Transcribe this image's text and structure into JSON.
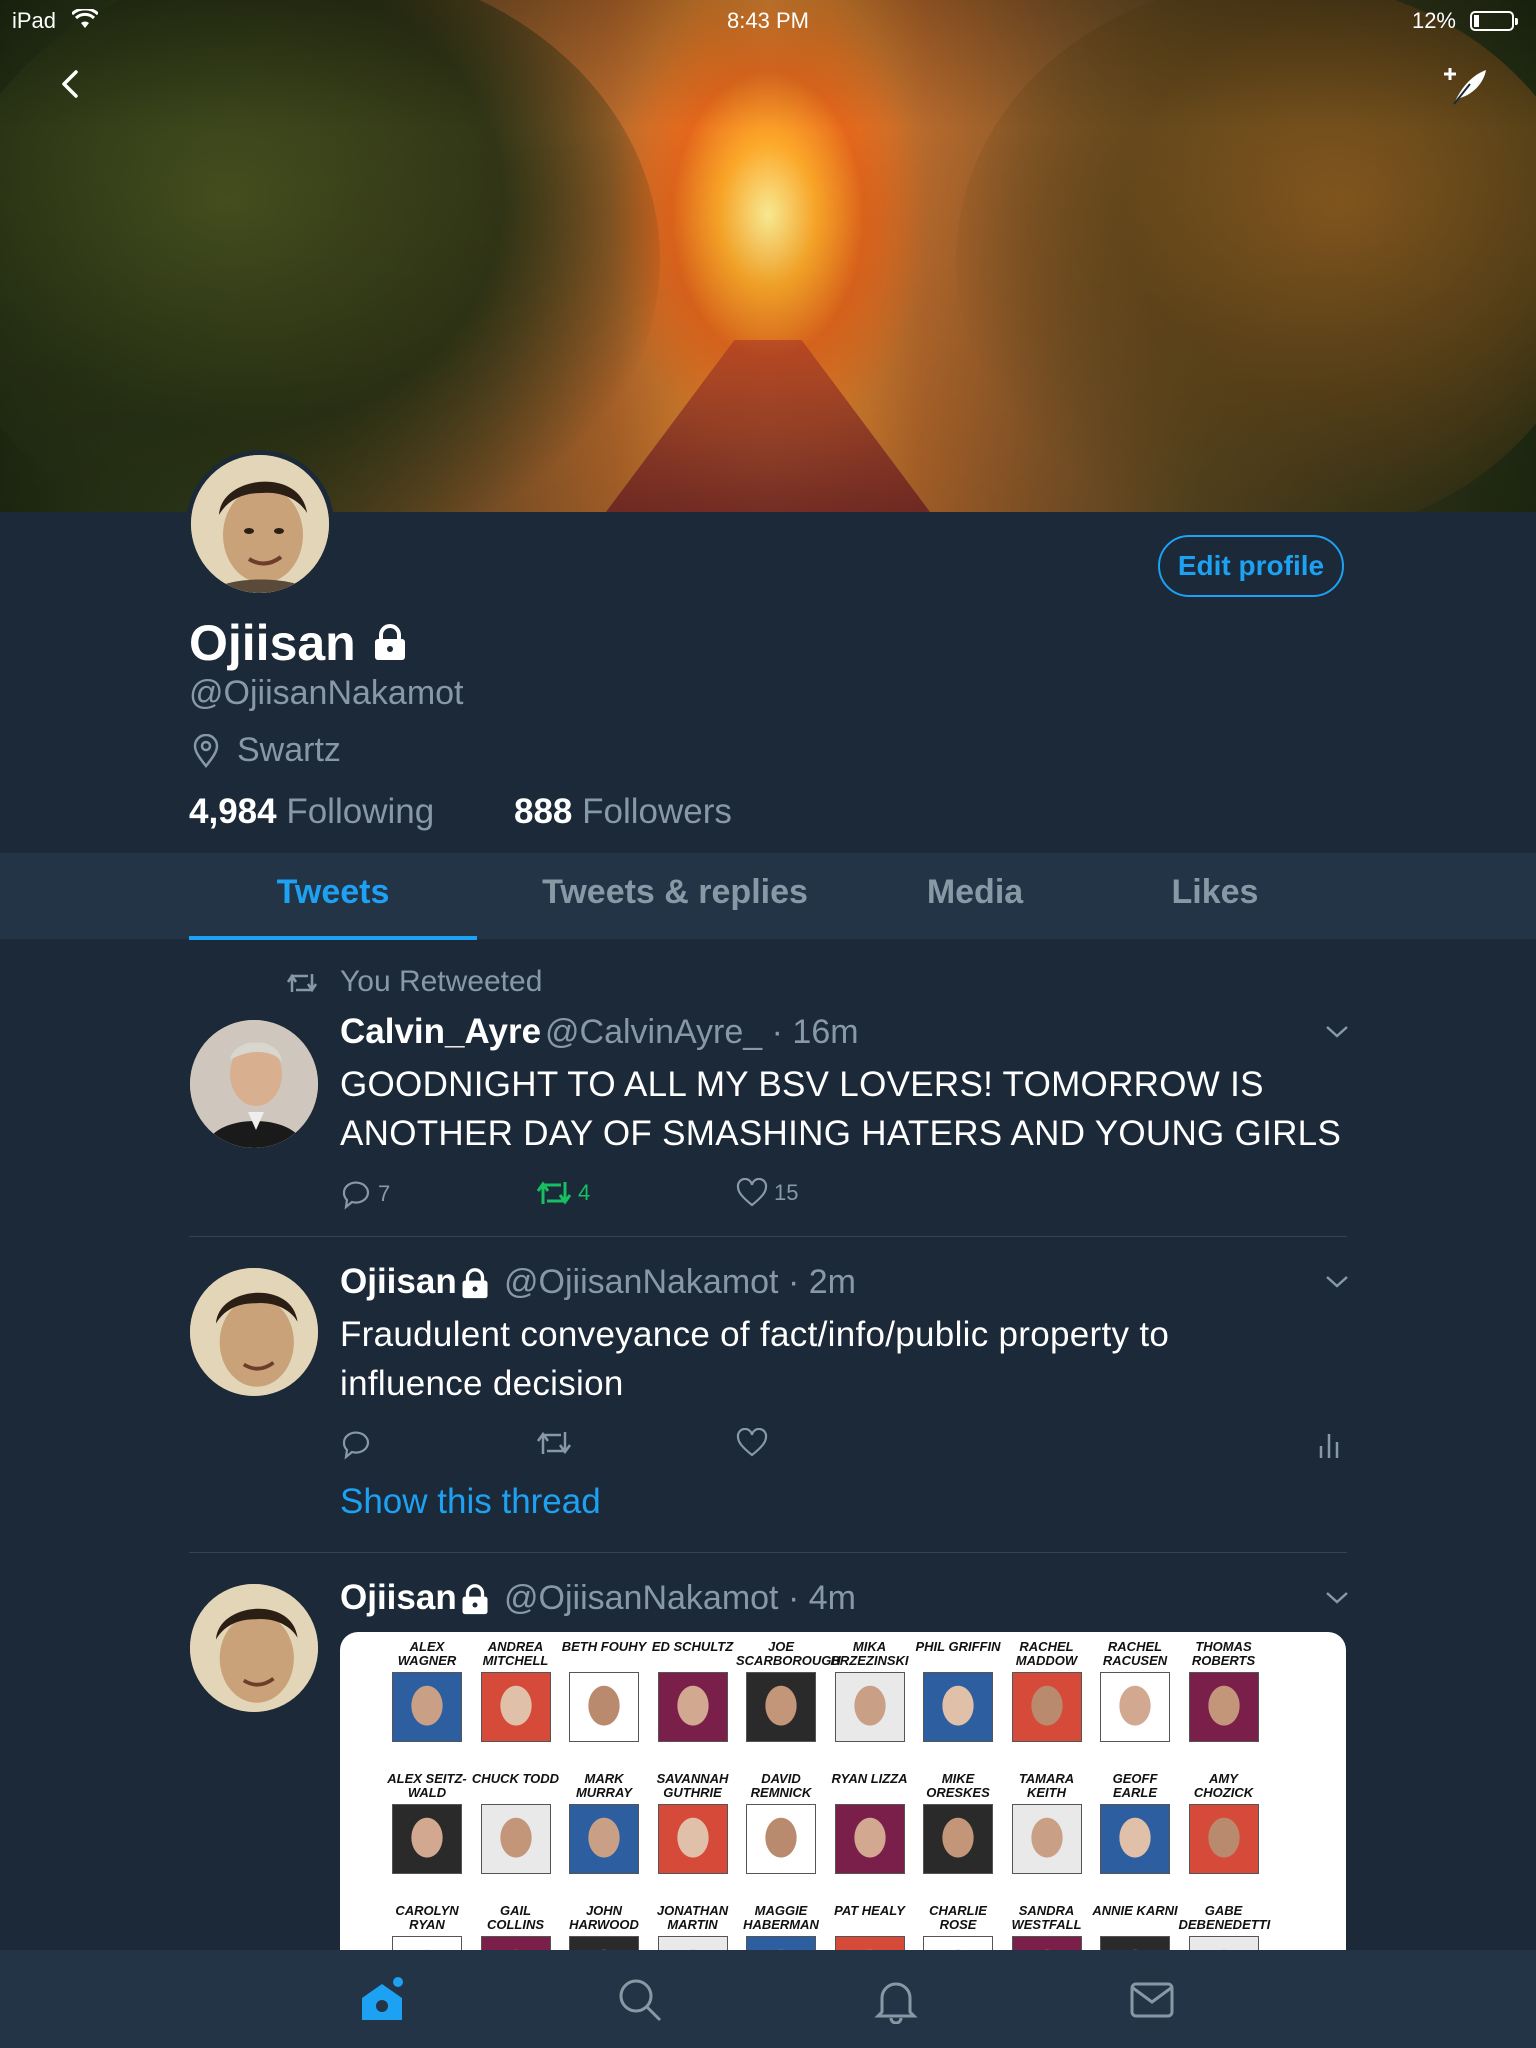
{
  "status_bar": {
    "device": "iPad",
    "time": "8:43 PM",
    "battery": "12%"
  },
  "profile": {
    "name": "Ojiisan",
    "handle": "@OjiisanNakamot",
    "location": "Swartz",
    "following_count": "4,984",
    "following_label": "Following",
    "followers_count": "888",
    "followers_label": "Followers",
    "edit_button": "Edit profile"
  },
  "tabs": [
    {
      "label": "Tweets",
      "active": true
    },
    {
      "label": "Tweets & replies",
      "active": false
    },
    {
      "label": "Media",
      "active": false
    },
    {
      "label": "Likes",
      "active": false
    }
  ],
  "tweets": [
    {
      "retweet_context": "You Retweeted",
      "name": "Calvin_Ayre",
      "handle": "@CalvinAyre_",
      "time": "16m",
      "text_line1": "GOODNIGHT TO ALL MY BSV LOVERS! TOMORROW IS",
      "text_line2": "ANOTHER DAY OF SMASHING HATERS AND YOUNG GIRLS",
      "replies": "7",
      "retweets": "4",
      "likes": "15"
    },
    {
      "name": "Ojiisan",
      "handle": "@OjiisanNakamot",
      "time": "2m",
      "text_line1": "Fraudulent conveyance of fact/info/public property to",
      "text_line2": "influence decision",
      "thread_link": "Show this thread"
    },
    {
      "name": "Ojiisan",
      "handle": "@OjiisanNakamot",
      "time": "4m",
      "media_names_row1": [
        "ALEX WAGNER",
        "ANDREA MITCHELL",
        "BETH FOUHY",
        "ED SCHULTZ",
        "JOE SCARBOROUGH",
        "MIKA BRZEZINSKI",
        "PHIL GRIFFIN",
        "RACHEL MADDOW",
        "RACHEL RACUSEN",
        "THOMAS ROBERTS"
      ],
      "media_names_row2": [
        "ALEX SEITZ-WALD",
        "CHUCK TODD",
        "MARK MURRAY",
        "SAVANNAH GUTHRIE",
        "DAVID REMNICK",
        "RYAN LIZZA",
        "MIKE ORESKES",
        "TAMARA KEITH",
        "GEOFF EARLE",
        "AMY CHOZICK"
      ],
      "media_names_row3": [
        "CAROLYN RYAN",
        "GAIL COLLINS",
        "JOHN HARWOOD",
        "JONATHAN MARTIN",
        "MAGGIE HABERMAN",
        "PAT HEALY",
        "CHARLIE ROSE",
        "SANDRA WESTFALL",
        "ANNIE KARNI",
        "GABE DEBENEDETTI"
      ]
    }
  ],
  "colors": {
    "background": "#1b2938",
    "accent": "#1da1f2",
    "secondary_text": "#8899a6",
    "retweet_green": "#17bf63"
  },
  "icons": [
    "wifi-icon",
    "battery-icon",
    "back-icon",
    "compose-icon",
    "lock-icon",
    "location-icon",
    "retweet-icon",
    "reply-icon",
    "like-icon",
    "analytics-icon",
    "chevron-down-icon",
    "home-icon",
    "search-icon",
    "notifications-icon",
    "messages-icon"
  ]
}
